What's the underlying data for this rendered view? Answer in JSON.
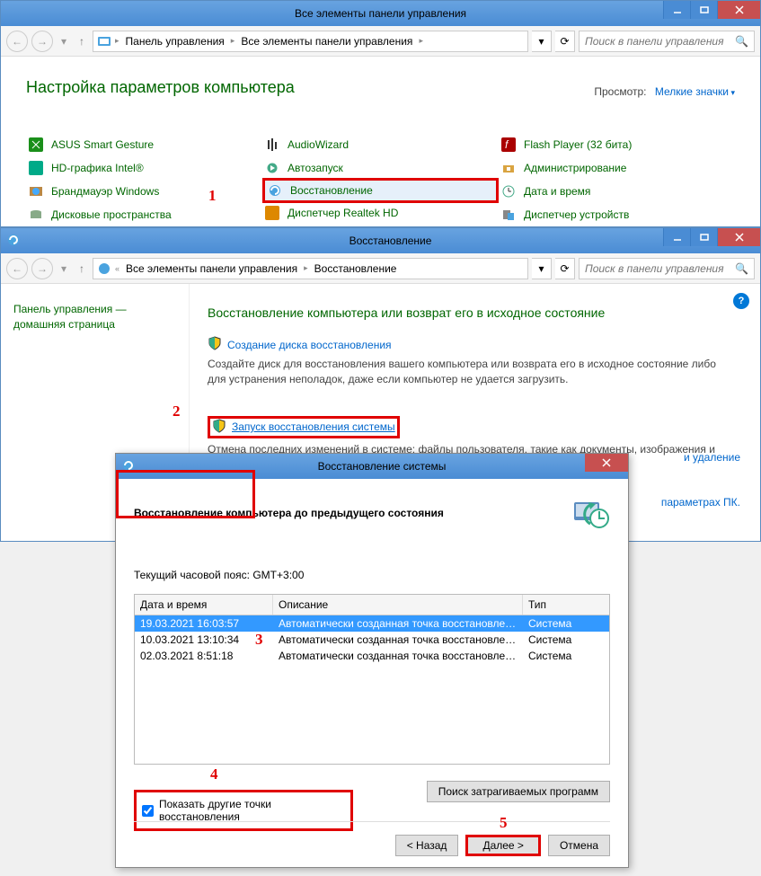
{
  "win1": {
    "title": "Все элементы панели управления",
    "breadcrumb": [
      "Панель управления",
      "Все элементы панели управления"
    ],
    "search_placeholder": "Поиск в панели управления",
    "heading": "Настройка параметров компьютера",
    "view_label": "Просмотр:",
    "view_value": "Мелкие значки",
    "items_col1": [
      "ASUS Smart Gesture",
      "HD-графика Intel®",
      "Брандмауэр Windows",
      "Дисковые пространства"
    ],
    "items_col2": [
      "AudioWizard",
      "Автозапуск",
      "Восстановление",
      "Диспетчер Realtek HD"
    ],
    "items_col3": [
      "Flash Player (32 бита)",
      "Администрирование",
      "Дата и время",
      "Диспетчер устройств"
    ]
  },
  "win2": {
    "title": "Восстановление",
    "breadcrumb": [
      "Все элементы панели управления",
      "Восстановление"
    ],
    "search_placeholder": "Поиск в панели управления",
    "sidebar": "Панель управления — домашняя страница",
    "heading": "Восстановление компьютера или возврат его в исходное состояние",
    "link1": "Создание диска восстановления",
    "desc1": "Создайте диск для восстановления вашего компьютера или возврата его в исходное состояние либо для устранения неполадок, даже если компьютер не удается загрузить.",
    "link2": "Запуск восстановления системы",
    "desc2": "Отмена последних изменений в системе; файлы пользователя, такие как документы, изображения и музыка, остаются без изменений.",
    "extra1": "и удаление",
    "extra2": "параметрах ПК."
  },
  "dialog": {
    "title": "Восстановление системы",
    "heading": "Восстановление компьютера до предыдущего состояния",
    "tz": "Текущий часовой пояс: GMT+3:00",
    "columns": [
      "Дата и время",
      "Описание",
      "Тип"
    ],
    "rows": [
      {
        "date": "19.03.2021 16:03:57",
        "desc": "Автоматически созданная точка восстановле…",
        "type": "Система"
      },
      {
        "date": "10.03.2021 13:10:34",
        "desc": "Автоматически созданная точка восстановле…",
        "type": "Система"
      },
      {
        "date": "02.03.2021 8:51:18",
        "desc": "Автоматически созданная точка восстановле…",
        "type": "Система"
      }
    ],
    "checkbox": "Показать другие точки восстановления",
    "search_affected": "Поиск затрагиваемых программ",
    "btn_back": "< Назад",
    "btn_next": "Далее >",
    "btn_cancel": "Отмена"
  },
  "annotations": {
    "a1": "1",
    "a2": "2",
    "a3": "3",
    "a4": "4",
    "a5": "5"
  }
}
